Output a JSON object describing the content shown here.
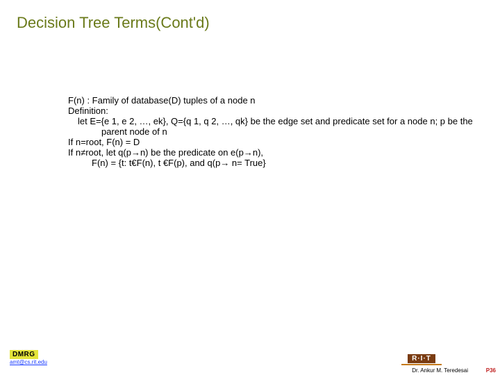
{
  "title": "Decision Tree Terms(Cont'd)",
  "body": {
    "l1": "F(n) : Family of database(D) tuples of a node n",
    "l2": "Definition:",
    "l3": "let E={e 1, e 2, …, ek}, Q={q 1, q 2, …, qk} be the edge set and predicate set for a node n; p be the parent node of n",
    "l4": "If n=root, F(n) = D",
    "l5": "If n≠root, let q(p→n) be the predicate on e(p→n),",
    "l6": "F(n) = {t: t€F(n), t €F(p), and q(p→ n= True}"
  },
  "footer": {
    "dmrg_label": "DMRG",
    "dmrg_link": "amt@cs.rit.edu",
    "rit_label": "R·I·T",
    "author": "Dr. Ankur M. Teredesai",
    "page": "P36"
  }
}
